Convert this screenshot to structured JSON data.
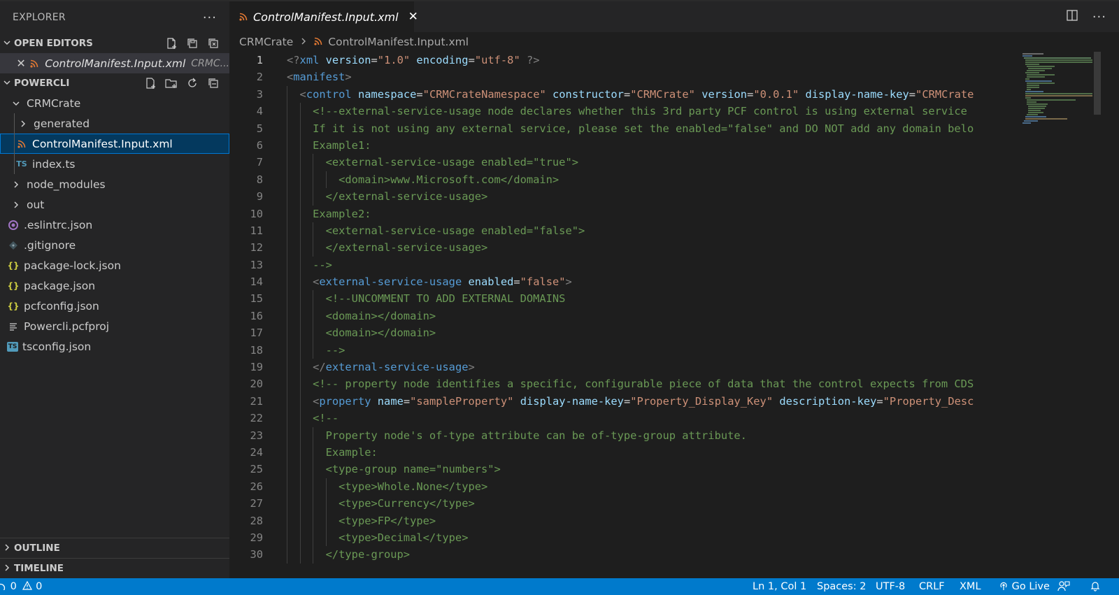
{
  "sidebar": {
    "title": "EXPLORER",
    "more": "···",
    "open_editors": {
      "title": "OPEN EDITORS",
      "items": [
        {
          "name": "ControlManifest.Input.xml",
          "description": "CRMC..."
        }
      ]
    },
    "project": {
      "title": "POWERCLI",
      "tree": [
        {
          "label": "CRMCrate",
          "kind": "folder-open"
        },
        {
          "label": "generated",
          "kind": "folder"
        },
        {
          "label": "ControlManifest.Input.xml",
          "kind": "xml"
        },
        {
          "label": "index.ts",
          "kind": "ts",
          "icon_text": "TS"
        },
        {
          "label": "node_modules",
          "kind": "folder"
        },
        {
          "label": "out",
          "kind": "folder"
        },
        {
          "label": ".eslintrc.json",
          "kind": "eslint"
        },
        {
          "label": ".gitignore",
          "kind": "git"
        },
        {
          "label": "package-lock.json",
          "kind": "json",
          "icon_text": "{}"
        },
        {
          "label": "package.json",
          "kind": "json",
          "icon_text": "{}"
        },
        {
          "label": "pcfconfig.json",
          "kind": "json",
          "icon_text": "{}"
        },
        {
          "label": "Powercli.pcfproj",
          "kind": "proj"
        },
        {
          "label": "tsconfig.json",
          "kind": "tsconfig",
          "icon_text": "TS"
        }
      ]
    },
    "outline": "OUTLINE",
    "timeline": "TIMELINE"
  },
  "editor": {
    "tab": {
      "label": "ControlManifest.Input.xml",
      "close": "✕"
    },
    "breadcrumb": {
      "folder": "CRMCrate",
      "file": "ControlManifest.Input.xml"
    },
    "lines": [
      {
        "n": "1"
      },
      {
        "n": "2"
      },
      {
        "n": "3"
      },
      {
        "n": "4"
      },
      {
        "n": "5"
      },
      {
        "n": "6"
      },
      {
        "n": "7"
      },
      {
        "n": "8"
      },
      {
        "n": "9"
      },
      {
        "n": "10"
      },
      {
        "n": "11"
      },
      {
        "n": "12"
      },
      {
        "n": "13"
      },
      {
        "n": "14"
      },
      {
        "n": "15"
      },
      {
        "n": "16"
      },
      {
        "n": "17"
      },
      {
        "n": "18"
      },
      {
        "n": "19"
      },
      {
        "n": "20"
      },
      {
        "n": "21"
      },
      {
        "n": "22"
      },
      {
        "n": "23"
      },
      {
        "n": "24"
      },
      {
        "n": "25"
      },
      {
        "n": "26"
      },
      {
        "n": "27"
      },
      {
        "n": "28"
      },
      {
        "n": "29"
      },
      {
        "n": "30"
      }
    ],
    "code": [
      [
        [
          "punc",
          "<?"
        ],
        [
          "tag",
          "xml"
        ],
        [
          "def",
          " "
        ],
        [
          "attr",
          "version"
        ],
        [
          "def",
          "="
        ],
        [
          "str",
          "\"1.0\""
        ],
        [
          "def",
          " "
        ],
        [
          "attr",
          "encoding"
        ],
        [
          "def",
          "="
        ],
        [
          "str",
          "\"utf-8\""
        ],
        [
          "def",
          " "
        ],
        [
          "punc",
          "?>"
        ]
      ],
      [
        [
          "punc",
          "<"
        ],
        [
          "tag",
          "manifest"
        ],
        [
          "punc",
          ">"
        ]
      ],
      [
        [
          "def",
          "  "
        ],
        [
          "punc",
          "<"
        ],
        [
          "tag",
          "control"
        ],
        [
          "def",
          " "
        ],
        [
          "attr",
          "namespace"
        ],
        [
          "def",
          "="
        ],
        [
          "str",
          "\"CRMCrateNamespace\""
        ],
        [
          "def",
          " "
        ],
        [
          "attr",
          "constructor"
        ],
        [
          "def",
          "="
        ],
        [
          "str",
          "\"CRMCrate\""
        ],
        [
          "def",
          " "
        ],
        [
          "attr",
          "version"
        ],
        [
          "def",
          "="
        ],
        [
          "str",
          "\"0.0.1\""
        ],
        [
          "def",
          " "
        ],
        [
          "attr",
          "display-name-key"
        ],
        [
          "def",
          "="
        ],
        [
          "str",
          "\"CRMCrate"
        ]
      ],
      [
        [
          "def",
          "    "
        ],
        [
          "cmt",
          "<!--external-service-usage node declares whether this 3rd party PCF control is using external service"
        ]
      ],
      [
        [
          "def",
          "    "
        ],
        [
          "cmt",
          "If it is not using any external service, please set the enabled=\"false\" and DO NOT add any domain belo"
        ]
      ],
      [
        [
          "def",
          "    "
        ],
        [
          "cmt",
          "Example1:"
        ]
      ],
      [
        [
          "def",
          "      "
        ],
        [
          "cmt",
          "<external-service-usage enabled=\"true\">"
        ]
      ],
      [
        [
          "def",
          "        "
        ],
        [
          "cmt",
          "<domain>www.Microsoft.com</domain>"
        ]
      ],
      [
        [
          "def",
          "      "
        ],
        [
          "cmt",
          "</external-service-usage>"
        ]
      ],
      [
        [
          "def",
          "    "
        ],
        [
          "cmt",
          "Example2:"
        ]
      ],
      [
        [
          "def",
          "      "
        ],
        [
          "cmt",
          "<external-service-usage enabled=\"false\">"
        ]
      ],
      [
        [
          "def",
          "      "
        ],
        [
          "cmt",
          "</external-service-usage>"
        ]
      ],
      [
        [
          "def",
          "    "
        ],
        [
          "cmt",
          "-->"
        ]
      ],
      [
        [
          "def",
          "    "
        ],
        [
          "punc",
          "<"
        ],
        [
          "tag",
          "external-service-usage"
        ],
        [
          "def",
          " "
        ],
        [
          "attr",
          "enabled"
        ],
        [
          "def",
          "="
        ],
        [
          "str",
          "\"false\""
        ],
        [
          "punc",
          ">"
        ]
      ],
      [
        [
          "def",
          "      "
        ],
        [
          "cmt",
          "<!--UNCOMMENT TO ADD EXTERNAL DOMAINS"
        ]
      ],
      [
        [
          "def",
          "      "
        ],
        [
          "cmt",
          "<domain></domain>"
        ]
      ],
      [
        [
          "def",
          "      "
        ],
        [
          "cmt",
          "<domain></domain>"
        ]
      ],
      [
        [
          "def",
          "      "
        ],
        [
          "cmt",
          "-->"
        ]
      ],
      [
        [
          "def",
          "    "
        ],
        [
          "punc",
          "</"
        ],
        [
          "tag",
          "external-service-usage"
        ],
        [
          "punc",
          ">"
        ]
      ],
      [
        [
          "def",
          "    "
        ],
        [
          "cmt",
          "<!-- property node identifies a specific, configurable piece of data that the control expects from CDS"
        ]
      ],
      [
        [
          "def",
          "    "
        ],
        [
          "punc",
          "<"
        ],
        [
          "tag",
          "property"
        ],
        [
          "def",
          " "
        ],
        [
          "attr",
          "name"
        ],
        [
          "def",
          "="
        ],
        [
          "str",
          "\"sampleProperty\""
        ],
        [
          "def",
          " "
        ],
        [
          "attr",
          "display-name-key"
        ],
        [
          "def",
          "="
        ],
        [
          "str",
          "\"Property_Display_Key\""
        ],
        [
          "def",
          " "
        ],
        [
          "attr",
          "description-key"
        ],
        [
          "def",
          "="
        ],
        [
          "str",
          "\"Property_Desc"
        ]
      ],
      [
        [
          "def",
          "    "
        ],
        [
          "cmt",
          "<!--"
        ]
      ],
      [
        [
          "def",
          "      "
        ],
        [
          "cmt",
          "Property node's of-type attribute can be of-type-group attribute."
        ]
      ],
      [
        [
          "def",
          "      "
        ],
        [
          "cmt",
          "Example:"
        ]
      ],
      [
        [
          "def",
          "      "
        ],
        [
          "cmt",
          "<type-group name=\"numbers\">"
        ]
      ],
      [
        [
          "def",
          "        "
        ],
        [
          "cmt",
          "<type>Whole.None</type>"
        ]
      ],
      [
        [
          "def",
          "        "
        ],
        [
          "cmt",
          "<type>Currency</type>"
        ]
      ],
      [
        [
          "def",
          "        "
        ],
        [
          "cmt",
          "<type>FP</type>"
        ]
      ],
      [
        [
          "def",
          "        "
        ],
        [
          "cmt",
          "<type>Decimal</type>"
        ]
      ],
      [
        [
          "def",
          "      "
        ],
        [
          "cmt",
          "</type-group>"
        ]
      ]
    ]
  },
  "statusbar": {
    "problems_errors": "0",
    "problems_warnings": "0",
    "cursor": "Ln 1, Col 1",
    "spaces": "Spaces: 2",
    "encoding": "UTF-8",
    "eol": "CRLF",
    "language": "XML",
    "go_live": "Go Live"
  },
  "colors": {
    "accent": "#007acc",
    "sidebar_bg": "#252526",
    "editor_bg": "#1e1e1e",
    "selection": "#04395e",
    "xml_icon": "#e37933",
    "ts_icon": "#519aba",
    "json_icon": "#cbcb41",
    "eslint_icon": "#a074c4"
  }
}
